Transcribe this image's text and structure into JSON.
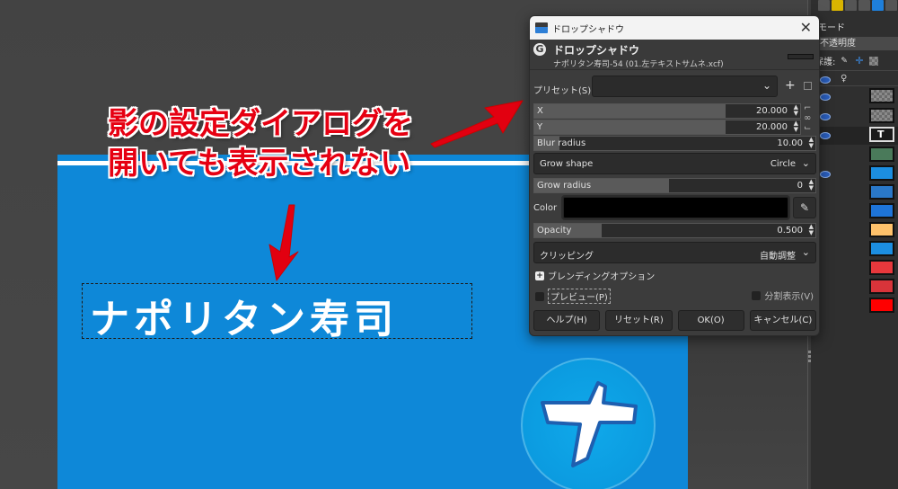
{
  "canvas": {
    "title_text": "ナポリタン寿司",
    "logo_glyph": "ナ",
    "background_color": "#0e88d8"
  },
  "annotation": {
    "line1": "影の設定ダイアログを",
    "line2": "開いても表示されない",
    "color": "#e60012"
  },
  "dock": {
    "mode_label": "モード",
    "opacity_label": "不透明度",
    "lock_label": "保護:",
    "layer_colors": [
      "#4a7a5a",
      "#1c8ee0",
      "#2a78c8",
      "#1e74d8",
      "#ffc26b",
      "#1c8ee0",
      "#e8383c",
      "#d8343a",
      "#ff0000"
    ]
  },
  "dialog": {
    "window_title": "ドロップシャドウ",
    "header_title": "ドロップシャドウ",
    "header_subtitle": "ナポリタン寿司-54 (01.左テキストサムネ.xcf)",
    "presets_label": "プリセット(S):",
    "presets_value": "",
    "fields": {
      "x": {
        "label": "X",
        "value": "20.000"
      },
      "y": {
        "label": "Y",
        "value": "20.000"
      },
      "blur_radius": {
        "label": "Blur radius",
        "value": "10.00"
      },
      "grow_shape": {
        "label": "Grow shape",
        "value": "Circle"
      },
      "grow_radius": {
        "label": "Grow radius",
        "value": "0"
      },
      "color": {
        "label": "Color",
        "value": "#000000"
      },
      "opacity": {
        "label": "Opacity",
        "value": "0.500"
      },
      "clipping": {
        "label": "クリッピング",
        "value": "自動調整"
      }
    },
    "blending_options_label": "ブレンディングオプション",
    "preview_label": "プレビュー(P)",
    "preview_checked": false,
    "split_view_label": "分割表示(V)",
    "split_view_checked": false,
    "buttons": {
      "help": "ヘルプ(H)",
      "reset": "リセット(R)",
      "ok": "OK(O)",
      "cancel": "キャンセル(C)"
    }
  }
}
